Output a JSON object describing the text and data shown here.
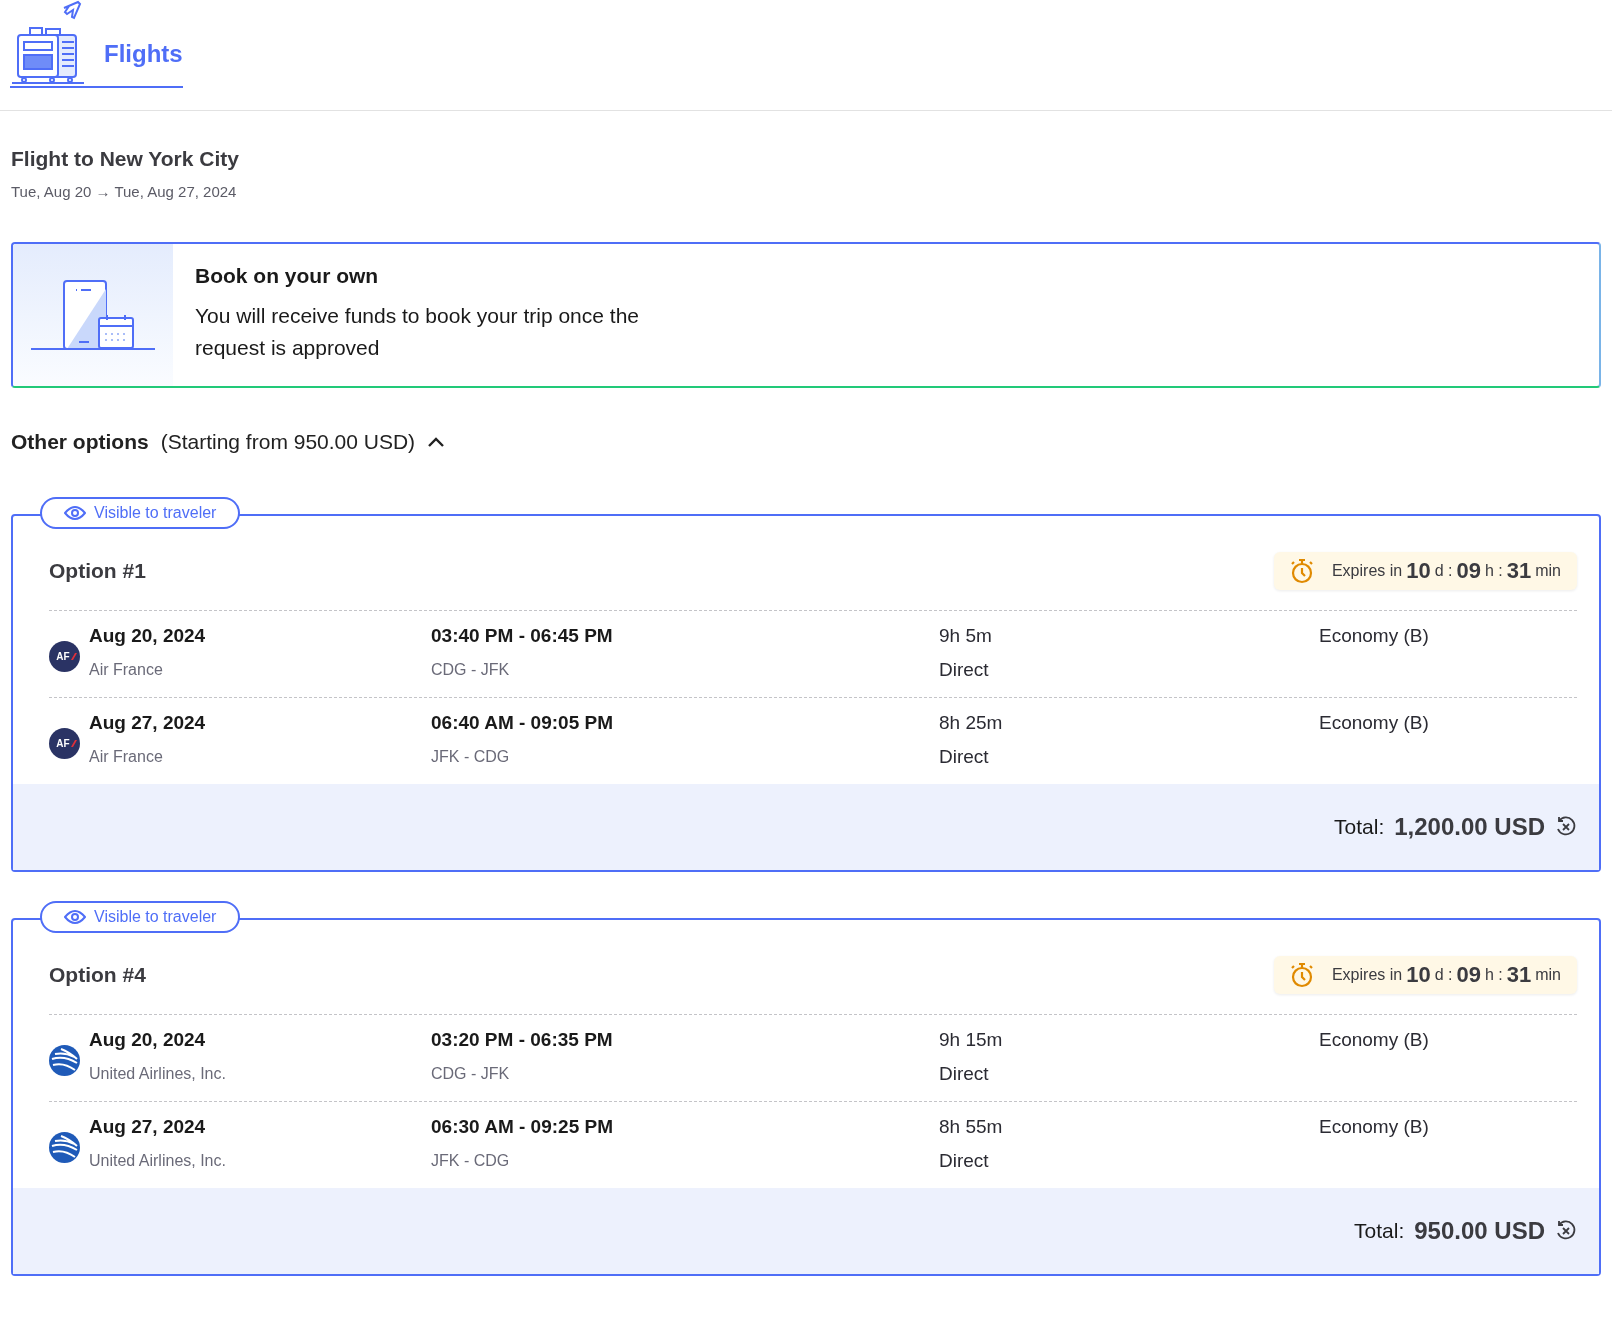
{
  "header": {
    "tabs": [
      {
        "label": "Flights",
        "selected": true
      }
    ]
  },
  "trip": {
    "title": "Flight to New York City",
    "dates": "Tue, Aug 20 → Tue, Aug 27, 2024"
  },
  "booking_card": {
    "title": "Book on your own",
    "text": "You will receive funds to book your trip once the request is approved"
  },
  "other_options": {
    "label": "Other options",
    "starting_from": "(Starting from 950.00 USD)",
    "expanded": true
  },
  "options": [
    {
      "badge": "Visible to traveler",
      "title": "Option #1",
      "expiry": {
        "prefix": "Expires in",
        "days": "10",
        "days_unit": "d :",
        "hours": "09",
        "hours_unit": "h :",
        "minutes": "31",
        "minutes_unit": "min"
      },
      "flights": [
        {
          "logo": {
            "kind": "air-france",
            "text": "AF"
          },
          "date": "Aug 20, 2024",
          "airline": "Air France",
          "times": "03:40 PM - 06:45 PM",
          "route": "CDG - JFK",
          "duration": "9h 5m",
          "stops": "Direct",
          "cabin": "Economy (B)"
        },
        {
          "logo": {
            "kind": "air-france",
            "text": "AF"
          },
          "date": "Aug 27, 2024",
          "airline": "Air France",
          "times": "06:40 AM - 09:05 PM",
          "route": "JFK - CDG",
          "duration": "8h 25m",
          "stops": "Direct",
          "cabin": "Economy (B)"
        }
      ],
      "total_label": "Total:",
      "total": "1,200.00 USD"
    },
    {
      "badge": "Visible to traveler",
      "title": "Option #4",
      "expiry": {
        "prefix": "Expires in",
        "days": "10",
        "days_unit": "d :",
        "hours": "09",
        "hours_unit": "h :",
        "minutes": "31",
        "minutes_unit": "min"
      },
      "flights": [
        {
          "logo": {
            "kind": "globe"
          },
          "date": "Aug 20, 2024",
          "airline": "United Airlines, Inc.",
          "times": "03:20 PM - 06:35 PM",
          "route": "CDG - JFK",
          "duration": "9h 15m",
          "stops": "Direct",
          "cabin": "Economy (B)"
        },
        {
          "logo": {
            "kind": "globe"
          },
          "date": "Aug 27, 2024",
          "airline": "United Airlines, Inc.",
          "times": "06:30 AM - 09:25 PM",
          "route": "JFK - CDG",
          "duration": "8h 55m",
          "stops": "Direct",
          "cabin": "Economy (B)"
        }
      ],
      "total_label": "Total:",
      "total": "950.00 USD"
    }
  ]
}
